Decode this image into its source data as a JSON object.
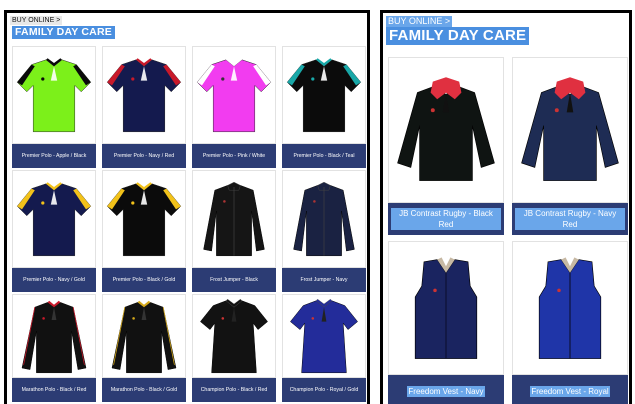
{
  "left": {
    "breadcrumb": "BUY ONLINE >",
    "title": "FAMILY DAY CARE",
    "products": [
      {
        "label": "Premier Polo - Apple / Black",
        "icon": "polo-shirt-icon",
        "body": "#7cf01a",
        "trim": "#0a0a0a"
      },
      {
        "label": "Premier Polo - Navy / Red",
        "icon": "polo-shirt-icon",
        "body": "#141a4e",
        "trim": "#c8192a"
      },
      {
        "label": "Premier Polo - Pink / White",
        "icon": "polo-shirt-icon",
        "body": "#f23cf0",
        "trim": "#ffffff"
      },
      {
        "label": "Premier Polo - Black / Teal",
        "icon": "polo-shirt-icon",
        "body": "#0b0b0b",
        "trim": "#19a8a8"
      },
      {
        "label": "Premier Polo - Navy / Gold",
        "icon": "polo-shirt-icon",
        "body": "#141a4e",
        "trim": "#f2c21a"
      },
      {
        "label": "Premier Polo - Black / Gold",
        "icon": "polo-shirt-icon",
        "body": "#0b0b0b",
        "trim": "#f2c21a"
      },
      {
        "label": "Frost Jumper - Black",
        "icon": "jumper-icon",
        "body": "#151515",
        "trim": "#151515"
      },
      {
        "label": "Frost Jumper - Navy",
        "icon": "jumper-icon",
        "body": "#1a2242",
        "trim": "#1a2242"
      },
      {
        "label": "Marathon Polo - Black / Red",
        "icon": "long-sleeve-polo-icon",
        "body": "#111111",
        "trim": "#c8192a"
      },
      {
        "label": "Marathon Polo - Black / Gold",
        "icon": "long-sleeve-polo-icon",
        "body": "#111111",
        "trim": "#d4a81a"
      },
      {
        "label": "Champion Polo - Black / Red",
        "icon": "ladies-polo-icon",
        "body": "#121212",
        "trim": "#121212"
      },
      {
        "label": "Champion Polo - Royal / Gold",
        "icon": "ladies-polo-icon",
        "body": "#232c9a",
        "trim": "#232c9a"
      }
    ]
  },
  "right": {
    "breadcrumb": "BUY ONLINE >",
    "title": "FAMILY DAY CARE",
    "products": [
      {
        "label": "JB Contrast Rugby - Black Red",
        "icon": "rugby-top-icon",
        "body": "#0f1412",
        "trim": "#e03040"
      },
      {
        "label": "JB Contrast Rugby - Navy Red",
        "icon": "rugby-top-icon",
        "body": "#1e2c54",
        "trim": "#e03040"
      },
      {
        "label": "Freedom Vest - Navy",
        "icon": "vest-icon",
        "body": "#1a2460",
        "trim": "#1a2460"
      },
      {
        "label": "Freedom Vest - Royal",
        "icon": "vest-icon",
        "body": "#1f35a8",
        "trim": "#1f35a8"
      }
    ]
  },
  "colors": {
    "label_bg": "#2c3c74",
    "heading_bg": "#4a8fe0",
    "highlight": "#6aa6ea"
  }
}
